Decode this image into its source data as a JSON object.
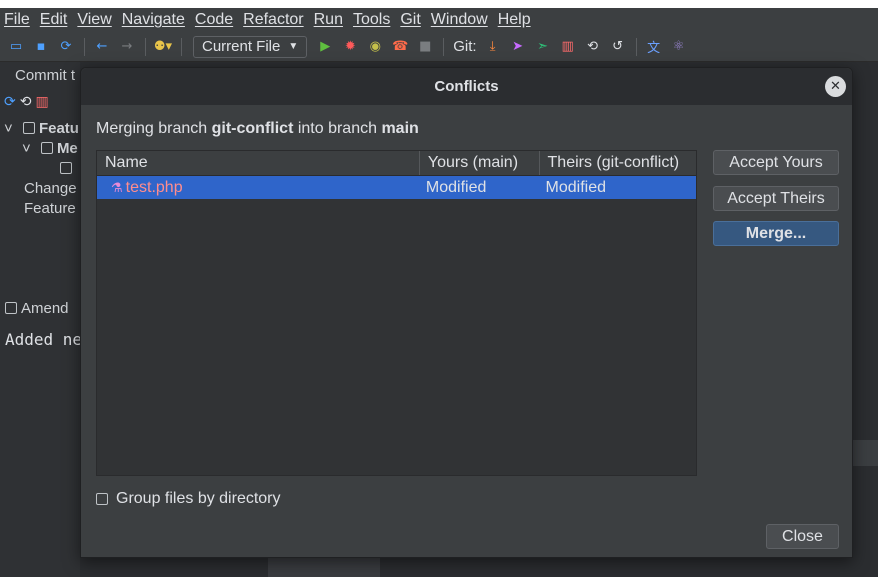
{
  "menubar": {
    "items": [
      "File",
      "Edit",
      "View",
      "Navigate",
      "Code",
      "Refactor",
      "Run",
      "Tools",
      "Git",
      "Window",
      "Help"
    ]
  },
  "toolbar": {
    "run_config": "Current File",
    "git_label": "Git:",
    "icons": [
      "folder-icon",
      "save-icon",
      "sync-icon",
      "back-icon",
      "forward-icon",
      "users-icon",
      "run-icon",
      "debug-icon",
      "coverage-icon",
      "profiler-icon",
      "stop-icon",
      "git-update-icon",
      "git-push-icon",
      "git-pull-icon",
      "git-compare-icon",
      "history-icon",
      "revert-icon",
      "translate-icon",
      "react-icon"
    ],
    "glyphs": {
      "folder": "🗀",
      "save": "■",
      "sync": "⟳",
      "back": "⬅",
      "forward": "➡",
      "users": "👥",
      "run": "▶",
      "debug": "✹",
      "coverage": "◉",
      "profiler": "☎",
      "stop": "■",
      "git_update": "⤓",
      "git_push": "➤",
      "git_pull": "➣",
      "git_compare": "▥",
      "history": "⟲",
      "revert": "↺",
      "translate": "文",
      "react": "⚛"
    },
    "colors": {
      "folder": "#4ea0ff",
      "save": "#4ea0ff",
      "sync": "#4ea0ff",
      "back": "#4ea0ff",
      "forward": "#7a7d80",
      "users": "#e8c44a",
      "run": "#5fbf3f",
      "debug": "#ff5a5a",
      "coverage": "#c5c04a",
      "profiler": "#ff6b4a",
      "stop": "#7a7d80",
      "git_update": "#ff8a3d",
      "git_push": "#c76bff",
      "git_pull": "#2ec47a",
      "git_compare": "#ff6b6b",
      "history": "#dfe1e5",
      "revert": "#dfe1e5",
      "translate": "#6ba0ff",
      "react": "#9b87d4"
    }
  },
  "left_panel": {
    "tab": "Commit t",
    "row1": "Featu",
    "row2": "Me",
    "row3": "Change",
    "row4": "Feature",
    "amend": "Amend",
    "message": "Added ne"
  },
  "dialog": {
    "title": "Conflicts",
    "close_glyph": "✕",
    "merge_prefix": "Merging branch ",
    "source_branch": "git-conflict",
    "merge_middle": " into branch ",
    "target_branch": "main",
    "columns": [
      "Name",
      "Yours (main)",
      "Theirs (git-conflict)"
    ],
    "rows": [
      {
        "name": "test.php",
        "yours": "Modified",
        "theirs": "Modified",
        "icon": "php-file-icon"
      }
    ],
    "file_icon_glyph": "⚗",
    "buttons": {
      "accept_yours": "Accept Yours",
      "accept_theirs": "Accept Theirs",
      "merge": "Merge...",
      "close": "Close"
    },
    "group_option": "Group files by directory"
  }
}
